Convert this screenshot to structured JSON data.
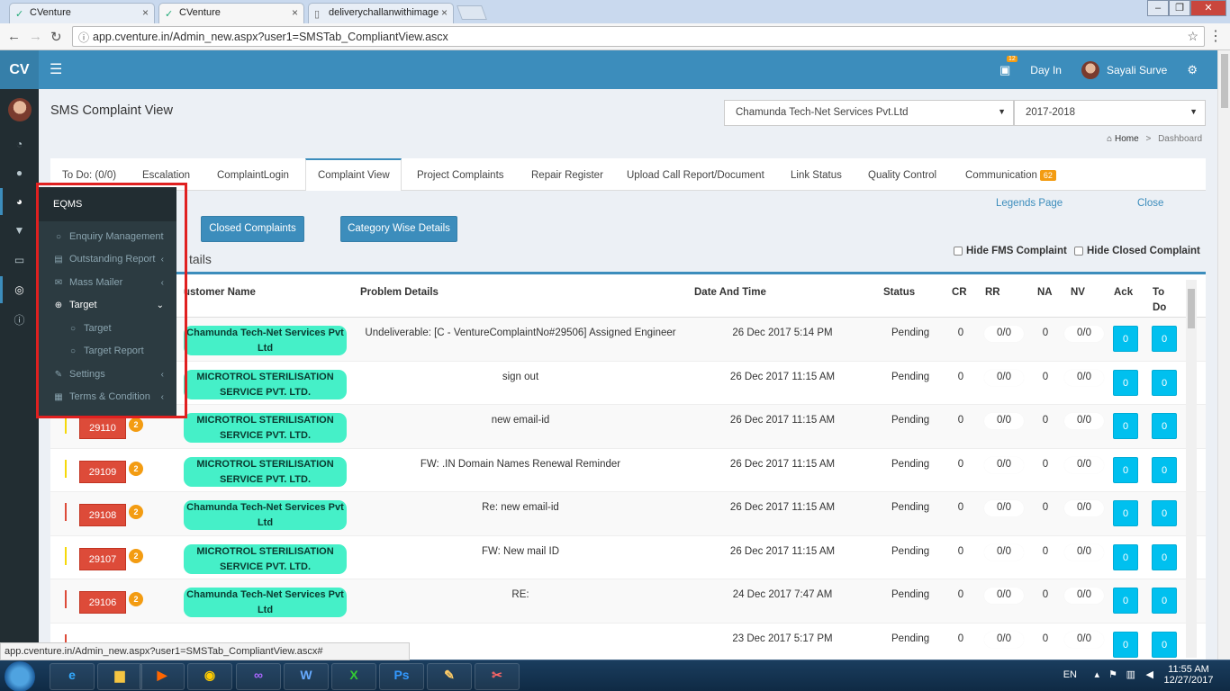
{
  "browser": {
    "tabs": [
      {
        "title": "CVenture",
        "active": false
      },
      {
        "title": "CVenture",
        "active": true
      },
      {
        "title": "deliverychallanwithimage",
        "active": false
      }
    ],
    "url": "app.cventure.in/Admin_new.aspx?user1=SMSTab_CompliantView.ascx",
    "status_url": "app.cventure.in/Admin_new.aspx?user1=SMSTab_CompliantView.ascx#"
  },
  "topbar": {
    "logo": "CV",
    "notif_count": "12",
    "day_in": "Day In",
    "user_name": "Sayali Surve"
  },
  "page": {
    "title": "SMS Complaint View",
    "company_select": "Chamunda Tech-Net Services Pvt.Ltd",
    "year_select": "2017-2018",
    "breadcrumb_home": "Home",
    "breadcrumb_current": "Dashboard"
  },
  "tabs": [
    {
      "label": "To Do: (0/0)"
    },
    {
      "label": "Escalation"
    },
    {
      "label": "ComplaintLogin"
    },
    {
      "label": "Complaint View"
    },
    {
      "label": "Project Complaints"
    },
    {
      "label": "Repair Register"
    },
    {
      "label": "Upload Call Report/Document"
    },
    {
      "label": "Link Status"
    },
    {
      "label": "Quality Control"
    },
    {
      "label": "Communication"
    }
  ],
  "communication_count": "62",
  "links": {
    "legends": "Legends Page",
    "close": "Close"
  },
  "buttons": {
    "closed": "Closed Complaints",
    "category": "Category Wise Details"
  },
  "partial_heading": "tails",
  "checkboxes": {
    "fms": "Hide FMS Complaint",
    "closed": "Hide Closed Complaint"
  },
  "table": {
    "headers": {
      "customer": "ustomer Name",
      "problem": "Problem Details",
      "date": "Date And Time",
      "status": "Status",
      "cr": "CR",
      "rr": "RR",
      "na": "NA",
      "nv": "NV",
      "ack": "Ack",
      "todo1": "To",
      "todo2": "Do"
    },
    "rows": [
      {
        "id": "",
        "count": "",
        "marker": "",
        "customer1": "Chamunda Tech-Net Services Pvt",
        "customer2": "Ltd",
        "problem": "Undeliverable: [C - VentureComplaintNo#29506] Assigned Engineer",
        "date": "26 Dec 2017 5:14 PM",
        "status": "Pending",
        "cr": "0",
        "rr": "0/0",
        "na": "0",
        "nv": "0/0",
        "ack": "0",
        "todo": "0"
      },
      {
        "id": "",
        "count": "",
        "marker": "",
        "customer1": "MICROTROL STERILISATION",
        "customer2": "SERVICE PVT. LTD.",
        "problem": "sign out",
        "date": "26 Dec 2017 11:15 AM",
        "status": "Pending",
        "cr": "0",
        "rr": "0/0",
        "na": "0",
        "nv": "0/0",
        "ack": "0",
        "todo": "0"
      },
      {
        "id": "29110",
        "count": "2",
        "marker": "#f5d90a",
        "customer1": "MICROTROL STERILISATION",
        "customer2": "SERVICE PVT. LTD.",
        "problem": "new email-id",
        "date": "26 Dec 2017 11:15 AM",
        "status": "Pending",
        "cr": "0",
        "rr": "0/0",
        "na": "0",
        "nv": "0/0",
        "ack": "0",
        "todo": "0"
      },
      {
        "id": "29109",
        "count": "2",
        "marker": "#f5d90a",
        "customer1": "MICROTROL STERILISATION",
        "customer2": "SERVICE PVT. LTD.",
        "problem": "FW: .IN Domain Names Renewal Reminder",
        "date": "26 Dec 2017 11:15 AM",
        "status": "Pending",
        "cr": "0",
        "rr": "0/0",
        "na": "0",
        "nv": "0/0",
        "ack": "0",
        "todo": "0"
      },
      {
        "id": "29108",
        "count": "2",
        "marker": "#dd4b39",
        "customer1": "Chamunda Tech-Net Services Pvt",
        "customer2": "Ltd",
        "problem": "Re: new email-id",
        "date": "26 Dec 2017 11:15 AM",
        "status": "Pending",
        "cr": "0",
        "rr": "0/0",
        "na": "0",
        "nv": "0/0",
        "ack": "0",
        "todo": "0"
      },
      {
        "id": "29107",
        "count": "2",
        "marker": "#f5d90a",
        "customer1": "MICROTROL STERILISATION",
        "customer2": "SERVICE PVT. LTD.",
        "problem": "FW: New mail ID",
        "date": "26 Dec 2017 11:15 AM",
        "status": "Pending",
        "cr": "0",
        "rr": "0/0",
        "na": "0",
        "nv": "0/0",
        "ack": "0",
        "todo": "0"
      },
      {
        "id": "29106",
        "count": "2",
        "marker": "#dd4b39",
        "customer1": "Chamunda Tech-Net Services Pvt",
        "customer2": "Ltd",
        "problem": "RE:",
        "date": "24 Dec 2017 7:47 AM",
        "status": "Pending",
        "cr": "0",
        "rr": "0/0",
        "na": "0",
        "nv": "0/0",
        "ack": "0",
        "todo": "0"
      },
      {
        "id": "",
        "count": "",
        "marker": "#dd4b39",
        "customer1": "",
        "customer2": "",
        "problem": "",
        "date": "23 Dec 2017 5:17 PM",
        "status": "Pending",
        "cr": "0",
        "rr": "0/0",
        "na": "0",
        "nv": "0/0",
        "ack": "0",
        "todo": "0"
      }
    ]
  },
  "flyout": {
    "header": "EQMS",
    "items": [
      {
        "label": "Enquiry Management"
      },
      {
        "label": "Outstanding Report"
      },
      {
        "label": "Mass Mailer"
      },
      {
        "label": "Target"
      },
      {
        "label": "Target"
      },
      {
        "label": "Target Report"
      },
      {
        "label": "Settings"
      },
      {
        "label": "Terms & Condition"
      }
    ]
  },
  "taskbar": {
    "lang": "EN",
    "time": "11:55 AM",
    "date": "12/27/2017"
  },
  "colors": {
    "primary": "#3c8dbc",
    "sidebar": "#222d32",
    "danger": "#dd4b39",
    "info": "#00c0ef",
    "warning": "#f39c12",
    "customer_pill": "#45f0c8"
  }
}
